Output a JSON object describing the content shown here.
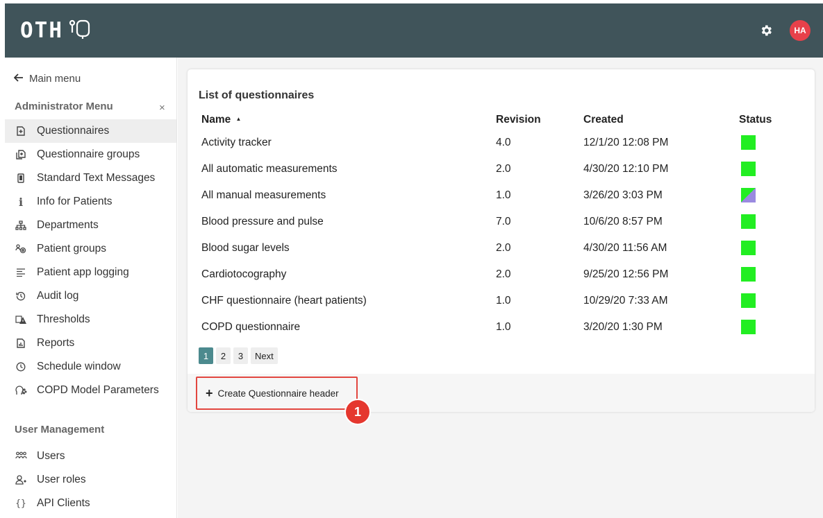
{
  "header": {
    "logo_text": "OTH",
    "avatar_initials": "HA",
    "accent_color": "#40545a"
  },
  "sidebar": {
    "back_label": "Main menu",
    "admin_title": "Administrator Menu",
    "close_label": "×",
    "admin_items": [
      {
        "label": "Questionnaires",
        "icon": "document-plus-icon"
      },
      {
        "label": "Questionnaire groups",
        "icon": "documents-icon"
      },
      {
        "label": "Standard Text Messages",
        "icon": "phone-icon"
      },
      {
        "label": "Info for Patients",
        "icon": "info-icon"
      },
      {
        "label": "Departments",
        "icon": "hierarchy-icon"
      },
      {
        "label": "Patient groups",
        "icon": "group-icon"
      },
      {
        "label": "Patient app logging",
        "icon": "lines-icon"
      },
      {
        "label": "Audit log",
        "icon": "history-icon"
      },
      {
        "label": "Thresholds",
        "icon": "warning-icon"
      },
      {
        "label": "Reports",
        "icon": "report-icon"
      },
      {
        "label": "Schedule window",
        "icon": "clock-icon"
      },
      {
        "label": "COPD Model Parameters",
        "icon": "head-icon"
      }
    ],
    "user_title": "User Management",
    "user_items": [
      {
        "label": "Users",
        "icon": "users-icon"
      },
      {
        "label": "User roles",
        "icon": "user-role-icon"
      },
      {
        "label": "API Clients",
        "icon": "braces-icon"
      }
    ]
  },
  "main": {
    "title": "List of questionnaires",
    "columns": {
      "name": "Name",
      "sort_indicator": "▲",
      "revision": "Revision",
      "created": "Created",
      "status": "Status"
    },
    "rows": [
      {
        "name": "Activity tracker",
        "revision": "4.0",
        "created": "12/1/20 12:08 PM",
        "status": "active"
      },
      {
        "name": "All automatic measurements",
        "revision": "2.0",
        "created": "4/30/20 12:10 PM",
        "status": "active"
      },
      {
        "name": "All manual measurements",
        "revision": "1.0",
        "created": "3/26/20 3:03 PM",
        "status": "mixed"
      },
      {
        "name": "Blood pressure and pulse",
        "revision": "7.0",
        "created": "10/6/20 8:57 PM",
        "status": "active"
      },
      {
        "name": "Blood sugar levels",
        "revision": "2.0",
        "created": "4/30/20 11:56 AM",
        "status": "active"
      },
      {
        "name": "Cardiotocography",
        "revision": "2.0",
        "created": "9/25/20 12:56 PM",
        "status": "active"
      },
      {
        "name": "CHF questionnaire (heart patients)",
        "revision": "1.0",
        "created": "10/29/20 7:33 AM",
        "status": "active"
      },
      {
        "name": "COPD questionnaire",
        "revision": "1.0",
        "created": "3/20/20 1:30 PM",
        "status": "active"
      }
    ],
    "pagination": {
      "pages": [
        "1",
        "2",
        "3"
      ],
      "next_label": "Next",
      "current": "1"
    },
    "create_button": {
      "icon_label": "+",
      "label": "Create Questionnaire header"
    },
    "callout_number": "1"
  },
  "colors": {
    "status_active": "#22ee22",
    "status_mixed_a": "#22ee22",
    "status_mixed_b": "#9a8ae0",
    "callout": "#e5372e"
  }
}
